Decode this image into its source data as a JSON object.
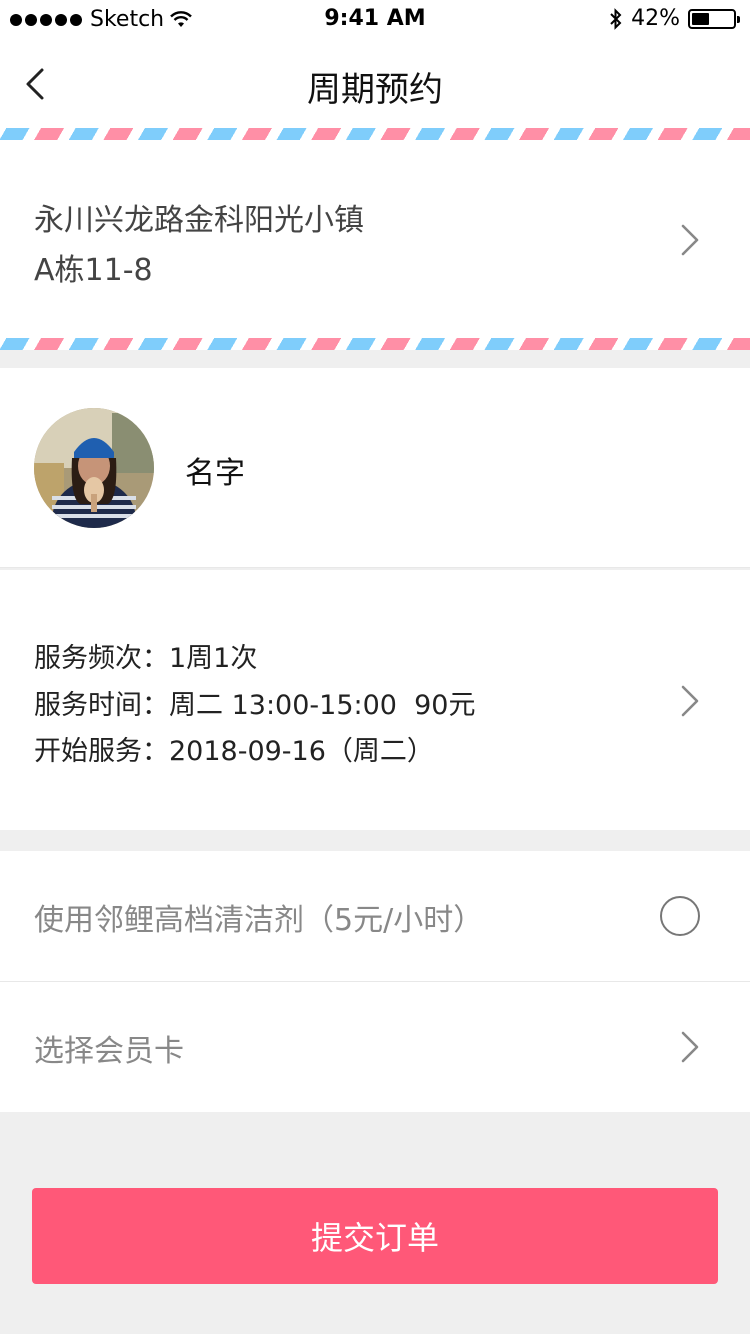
{
  "status_bar": {
    "carrier": "Sketch",
    "time": "9:41 AM",
    "battery_percent": "42%",
    "battery_level": 0.42
  },
  "nav": {
    "title": "周期预约"
  },
  "address": {
    "line1": "永川兴龙路金科阳光小镇",
    "line2": "A栋11-8"
  },
  "user": {
    "name": "名字"
  },
  "service": {
    "frequency": "服务频次：1周1次",
    "time": "服务时间：周二 13:00-15:00  90元",
    "start": "开始服务：2018-09-16（周二）"
  },
  "options": {
    "cleaner_label": "使用邻鲤高档清洁剂（5元/小时）",
    "member_card_label": "选择会员卡"
  },
  "submit": {
    "label": "提交订单"
  },
  "colors": {
    "accent": "#ff5878",
    "stripe_pink": "#ff8fa6",
    "stripe_blue": "#7fcdfb"
  }
}
